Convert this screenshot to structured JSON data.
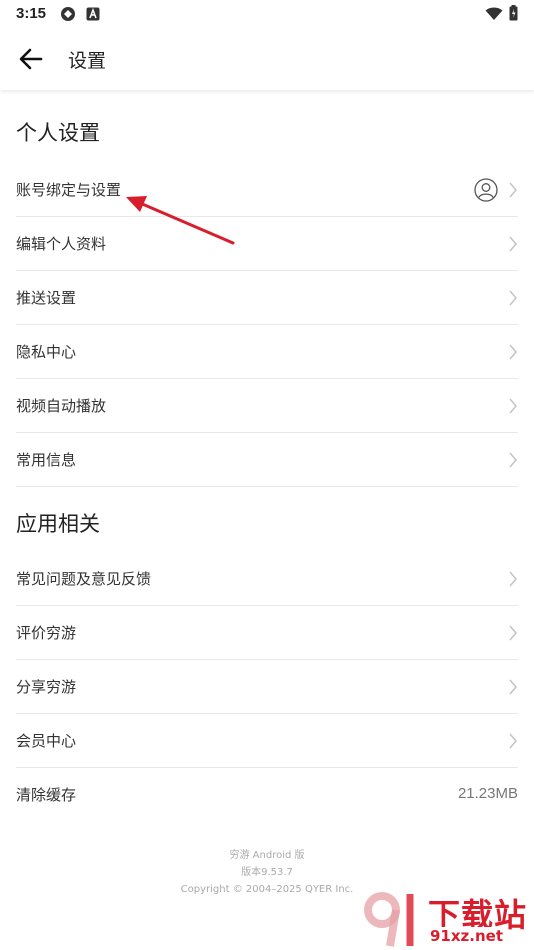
{
  "status_bar": {
    "time": "3:15",
    "left_icons": [
      "vpn-icon",
      "a-notification-icon"
    ],
    "right_icons": [
      "wifi-icon",
      "battery-icon"
    ]
  },
  "app_bar": {
    "back_icon": "arrow-left-icon",
    "title": "设置"
  },
  "sections": {
    "personal": {
      "title": "个人设置",
      "items": [
        {
          "label": "账号绑定与设置",
          "trailing_icon": "user-avatar-icon"
        },
        {
          "label": "编辑个人资料"
        },
        {
          "label": "推送设置"
        },
        {
          "label": "隐私中心"
        },
        {
          "label": "视频自动播放"
        },
        {
          "label": "常用信息"
        }
      ]
    },
    "app": {
      "title": "应用相关",
      "items": [
        {
          "label": "常见问题及意见反馈"
        },
        {
          "label": "评价穷游"
        },
        {
          "label": "分享穷游"
        },
        {
          "label": "会员中心"
        },
        {
          "label": "清除缓存",
          "value": "21.23MB"
        }
      ]
    }
  },
  "footer": {
    "line1": "穷游 Android 版",
    "line2": "版本9.53.7",
    "line3": "Copyright © 2004–2025 QYER Inc."
  },
  "watermark": {
    "logo_text": "下载站",
    "url": "91xz.net"
  },
  "colors": {
    "annotation_arrow": "#d81e2c",
    "chevron": "#c4c4c4",
    "divider": "#e8e8e8"
  }
}
